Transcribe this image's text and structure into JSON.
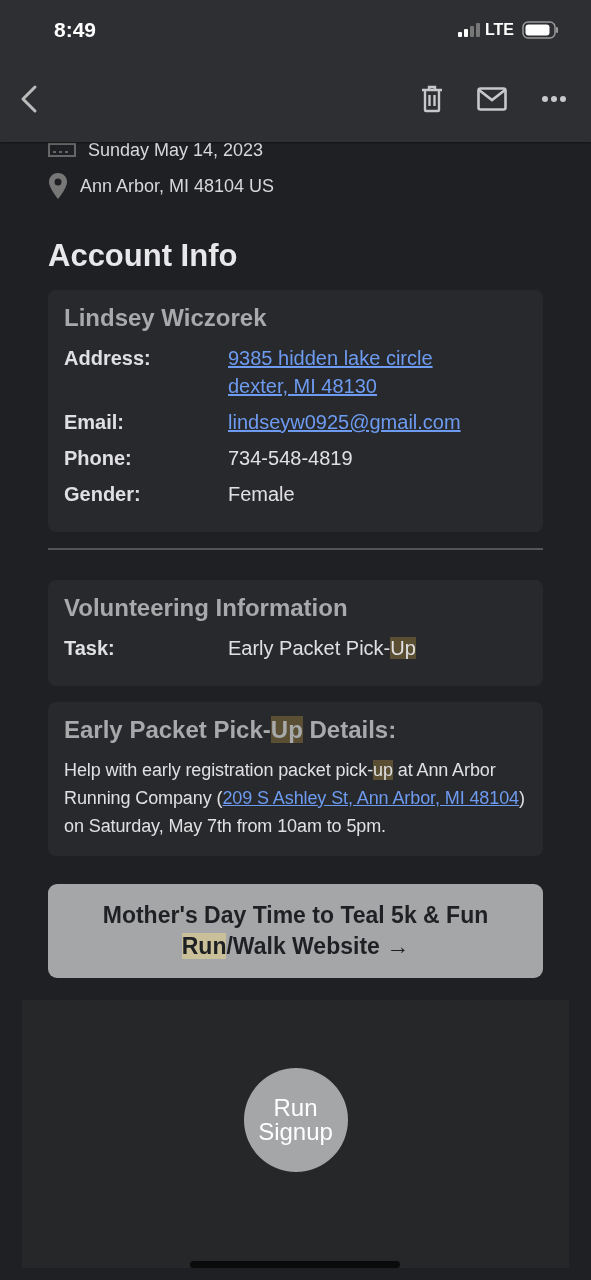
{
  "status_bar": {
    "time": "8:49",
    "network": "LTE"
  },
  "event": {
    "date": "Sunday May 14, 2023",
    "location": "Ann Arbor, MI 48104 US"
  },
  "account": {
    "heading": "Account Info",
    "name": "Lindsey Wiczorek",
    "fields": [
      {
        "label": "Address:",
        "kind": "link",
        "value": [
          "9385 hidden lake circle",
          "dexter, MI 48130"
        ]
      },
      {
        "label": "Email:",
        "kind": "link",
        "value": [
          "lindseyw0925@gmail.com"
        ]
      },
      {
        "label": "Phone:",
        "kind": "text",
        "value": [
          "734-548-4819"
        ]
      },
      {
        "label": "Gender:",
        "kind": "text",
        "value": [
          "Female"
        ]
      }
    ]
  },
  "volunteering": {
    "heading": "Volunteering Information",
    "label": "Task:",
    "value": [
      {
        "text": "Early Packet Pick-",
        "highlight": false
      },
      {
        "text": "Up",
        "highlight": true
      }
    ]
  },
  "details": {
    "heading": [
      {
        "text": "Early Packet Pick-",
        "highlight": false
      },
      {
        "text": "Up",
        "highlight": true
      },
      {
        "text": " Details:",
        "highlight": false
      }
    ],
    "body": [
      {
        "text": "Help with early registration packet pick-",
        "kind": "text",
        "highlight": false
      },
      {
        "text": "up",
        "kind": "text",
        "highlight": true
      },
      {
        "text": " at Ann Arbor Running Company (",
        "kind": "text",
        "highlight": false
      },
      {
        "text": "209 S Ashley St, Ann Arbor, MI 48104",
        "kind": "link"
      },
      {
        "text": ") on Saturday, May 7th from 10am to 5pm.",
        "kind": "text",
        "highlight": false
      }
    ]
  },
  "website_button": [
    {
      "text": "Mother's Day Time to Teal 5k & Fun ",
      "highlight": false
    },
    {
      "text": "Run",
      "highlight": true
    },
    {
      "text": "/Walk Website →",
      "highlight": false
    }
  ],
  "footer": {
    "logo": "Run Signup"
  }
}
